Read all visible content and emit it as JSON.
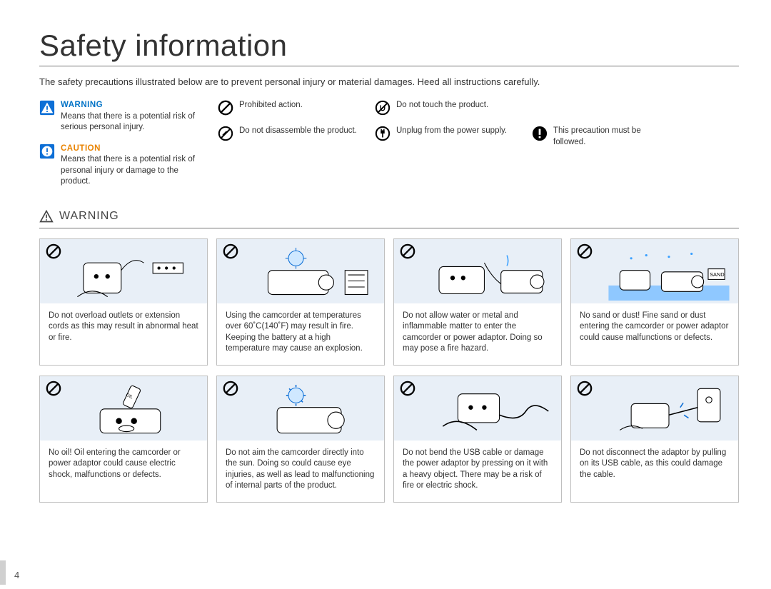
{
  "page": {
    "title": "Safety information",
    "intro": "The safety precautions illustrated below are to prevent personal injury or material damages. Heed all instructions carefully.",
    "number": "4"
  },
  "legend": {
    "warning": {
      "label": "WARNING",
      "desc": "Means that there is a potential risk of serious personal injury."
    },
    "caution": {
      "label": "CAUTION",
      "desc": "Means that there is a potential risk of personal injury or damage to the product."
    },
    "prohibited": "Prohibited action.",
    "disassemble": "Do not disassemble the product.",
    "touch": "Do not touch the product.",
    "unplug": "Unplug from the power supply.",
    "follow": "This precaution must be followed."
  },
  "section": {
    "heading": "WARNING"
  },
  "cards": [
    {
      "text": "Do not overload outlets or extension cords as this may result in abnormal heat or fire."
    },
    {
      "text": "Using the camcorder at temperatures over 60˚C(140˚F) may result in fire. Keeping the battery at a high temperature may cause an explosion."
    },
    {
      "text": "Do not allow water or metal and inflammable matter to enter the camcorder or power adaptor. Doing so may pose a fire hazard."
    },
    {
      "text": "No sand or dust! Fine sand or dust entering the camcorder or power adaptor could cause malfunctions or defects."
    },
    {
      "text": "No oil! Oil entering the camcorder or power adaptor could cause electric shock, malfunctions or defects."
    },
    {
      "text": "Do not aim the camcorder directly into the sun. Doing so could cause eye injuries, as well as lead to malfunctioning of internal parts of the product."
    },
    {
      "text": "Do not bend the USB cable or damage the power adaptor by pressing on it with a heavy object. There may be a risk of fire or electric shock."
    },
    {
      "text": "Do not disconnect the adaptor by pulling on its USB cable, as this could damage the cable."
    }
  ]
}
